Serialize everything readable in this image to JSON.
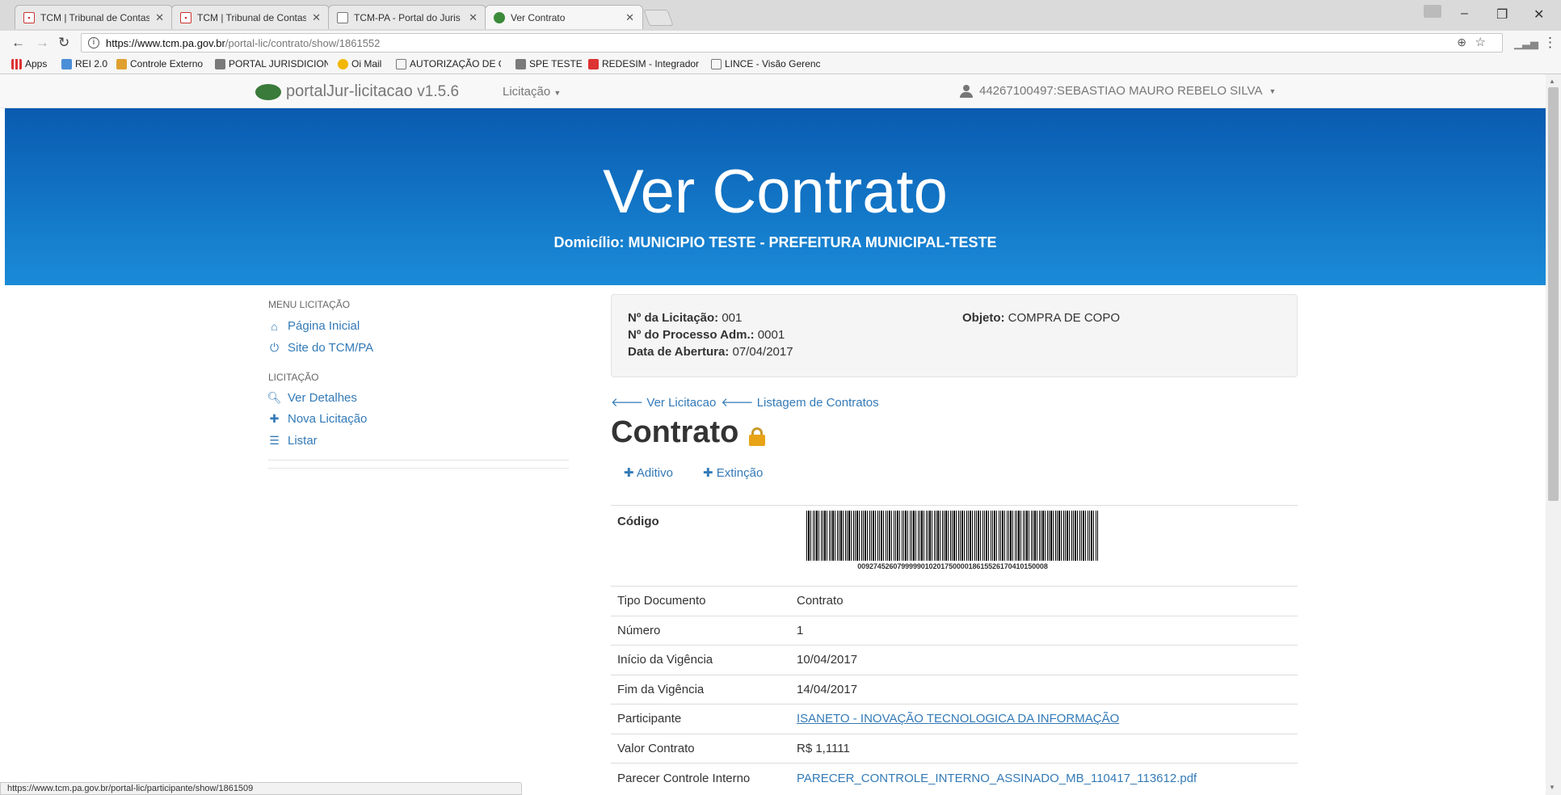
{
  "browser": {
    "tabs": [
      {
        "label": "TCM | Tribunal de Contas",
        "favicon": "tcm-icon"
      },
      {
        "label": "TCM | Tribunal de Contas",
        "favicon": "tcm-icon"
      },
      {
        "label": "TCM-PA - Portal do Juris",
        "favicon": "page-icon"
      },
      {
        "label": "Ver Contrato",
        "favicon": "portaljur-icon"
      }
    ],
    "url_host": "https://www.tcm.pa.gov.br",
    "url_path": "/portal-lic/contrato/show/1861552",
    "bookmarks": [
      "Apps",
      "REI 2.0",
      "Controle Externo",
      "PORTAL JURISDICION",
      "Oi Mail",
      "AUTORIZAÇÃO DE GE",
      "SPE TESTE",
      "REDESIM - Integrador",
      "LINCE - Visão Gerenc"
    ],
    "status_url": "https://www.tcm.pa.gov.br/portal-lic/participante/show/1861509"
  },
  "navbar": {
    "brand": "portalJur-licitacao",
    "version": "v1.5.6",
    "menu": "Licitação",
    "user": "44267100497:SEBASTIAO MAURO REBELO SILVA"
  },
  "banner": {
    "title": "Ver Contrato",
    "subtitle": "Domicílio: MUNICIPIO TESTE - PREFEITURA MUNICIPAL-TESTE"
  },
  "sidebar": {
    "menu_heading": "MENU LICITAÇÃO",
    "menu_items": [
      {
        "label": "Página Inicial",
        "icon": "home-icon"
      },
      {
        "label": "Site do TCM/PA",
        "icon": "power-icon"
      }
    ],
    "lic_heading": "LICITAÇÃO",
    "lic_items": [
      {
        "label": "Ver Detalhes",
        "icon": "zoom-icon"
      },
      {
        "label": "Nova Licitação",
        "icon": "plus-icon"
      },
      {
        "label": "Listar",
        "icon": "list-icon"
      }
    ]
  },
  "info": {
    "licitacao_label": "Nº da Licitação:",
    "licitacao_value": "001",
    "processo_label": "Nº do Processo Adm.:",
    "processo_value": "0001",
    "abertura_label": "Data de Abertura:",
    "abertura_value": "07/04/2017",
    "objeto_label": "Objeto:",
    "objeto_value": "COMPRA DE COPO"
  },
  "links": {
    "ver_licitacao": "Ver Licitacao",
    "listagem": "Listagem de Contratos"
  },
  "contrato": {
    "heading": "Contrato",
    "aditivo": "Aditivo",
    "extincao": "Extinção",
    "codigo_label": "Código",
    "barcode_number": "009274526079999901020175000018615526170410150008"
  },
  "details": [
    {
      "key": "Tipo Documento",
      "value": "Contrato"
    },
    {
      "key": "Número",
      "value": "1"
    },
    {
      "key": "Início da Vigência",
      "value": "10/04/2017"
    },
    {
      "key": "Fim da Vigência",
      "value": "14/04/2017"
    },
    {
      "key": "Participante",
      "value": "ISANETO - INOVAÇÃO TECNOLOGICA DA INFORMAÇÃO"
    },
    {
      "key": "Valor Contrato",
      "value": "R$ 1,1111"
    },
    {
      "key": "Parecer Controle Interno",
      "value": "PARECER_CONTROLE_INTERNO_ASSINADO_MB_110417_113612.pdf"
    }
  ],
  "colors": {
    "link": "#337ab7",
    "banner_top": "#0a5bb0",
    "banner_bottom": "#1a8bd8",
    "lock": "#e8a317"
  }
}
